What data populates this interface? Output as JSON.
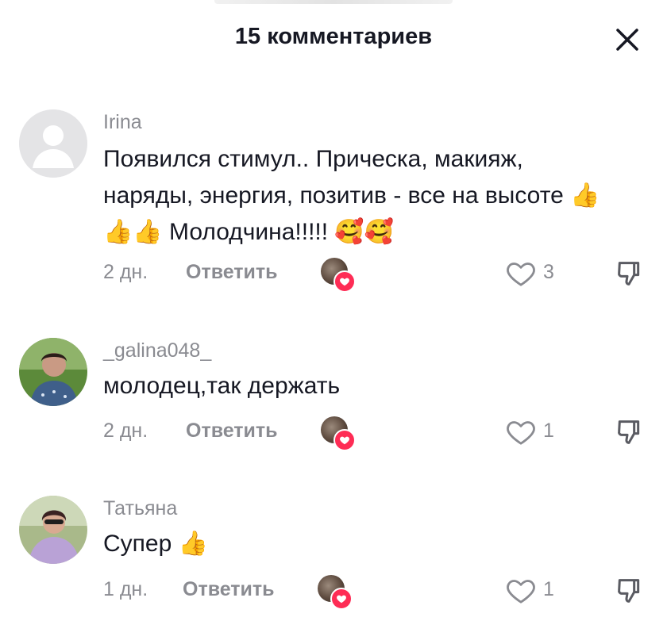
{
  "header": {
    "title": "15 комментариев"
  },
  "comments": [
    {
      "username": "Irina",
      "text": "Появился стимул.. Прическа, макияж, наряды, энергия, позитив - все на высоте 👍👍👍 Молодчина!!!!! 🥰🥰",
      "time": "2 дн.",
      "reply_label": "Ответить",
      "likes": "3",
      "avatar": "default-avatar"
    },
    {
      "username": "_galina048_",
      "text": "молодец,так держать",
      "time": "2 дн.",
      "reply_label": "Ответить",
      "likes": "1",
      "avatar": "photo-avatar"
    },
    {
      "username": "Татьяна",
      "text": "Супер 👍",
      "time": "1 дн.",
      "reply_label": "Ответить",
      "likes": "1",
      "avatar": "photo-avatar"
    }
  ],
  "colors": {
    "text_primary": "#161823",
    "text_secondary": "#8a8b91",
    "heart_badge": "#fe2c55"
  },
  "icons": [
    "close-icon",
    "heart-outline-icon",
    "dislike-icon",
    "creator-liked-heart-icon"
  ]
}
